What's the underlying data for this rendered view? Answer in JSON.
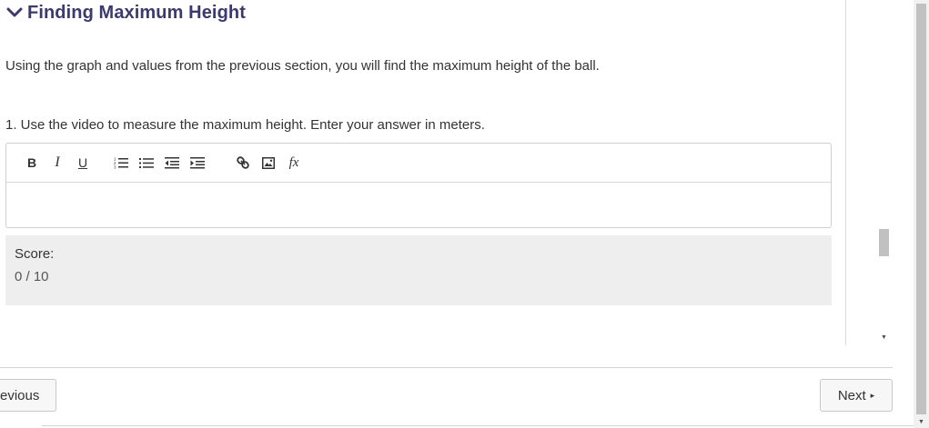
{
  "section": {
    "title": "Finding Maximum Height",
    "intro": "Using the graph and values from the previous section, you will find the maximum height of the ball.",
    "question": "1. Use the video to measure the maximum height. Enter your answer in meters."
  },
  "editor": {
    "toolbar": {
      "bold": "B",
      "italic": "I",
      "underline": "U",
      "formula": "fx"
    },
    "answer_value": ""
  },
  "score": {
    "label": "Score:",
    "value": "0 / 10"
  },
  "navigation": {
    "previous_label": "revious",
    "next_label": "Next",
    "next_arrow": "▸"
  },
  "icons": {
    "chevron": "chevron-down-icon",
    "ordered_list": "ordered-list-icon",
    "bullet_list": "bullet-list-icon",
    "outdent": "outdent-icon",
    "indent": "indent-icon",
    "link": "link-icon",
    "image": "image-icon"
  },
  "colors": {
    "heading": "#3a3a6e",
    "score_background": "#eeeeee"
  }
}
